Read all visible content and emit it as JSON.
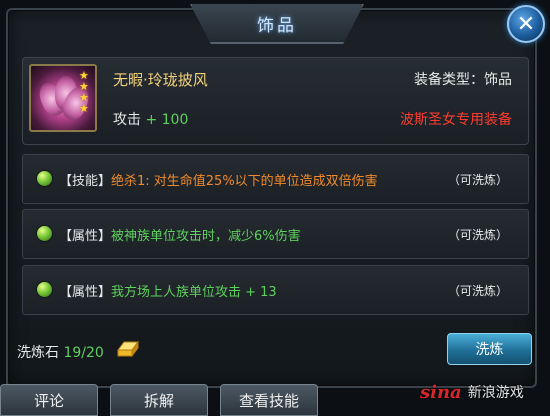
{
  "window": {
    "title": "饰品",
    "close_icon": "close-icon"
  },
  "item": {
    "name": "无暇·玲珑披风",
    "equip_type": "装备类型：饰品",
    "stat_label": "攻击",
    "stat_value": "+ 100",
    "exclusive": "波斯圣女专用装备",
    "stars": 4
  },
  "attributes": [
    {
      "tag": "【技能】",
      "desc": "绝杀1: 对生命值25%以下的单位造成双倍伤害",
      "desc_color": "#f08a2a",
      "wash": "（可洗炼）"
    },
    {
      "tag": "【属性】",
      "desc": "被神族单位攻击时，减少6%伤害",
      "desc_color": "#5ed05e",
      "wash": "（可洗炼）"
    },
    {
      "tag": "【属性】",
      "desc": "我方场上人族单位攻击 + 13",
      "desc_color": "#5ed05e",
      "wash": "（可洗炼）"
    }
  ],
  "wash_stone": {
    "label": "洗炼石",
    "count": "19/20"
  },
  "wash_button": "洗炼",
  "bottom_buttons": {
    "comment": "评论",
    "disassemble": "拆解",
    "view_skill": "查看技能"
  },
  "watermark": {
    "brand": "sina",
    "text": "新浪游戏"
  }
}
